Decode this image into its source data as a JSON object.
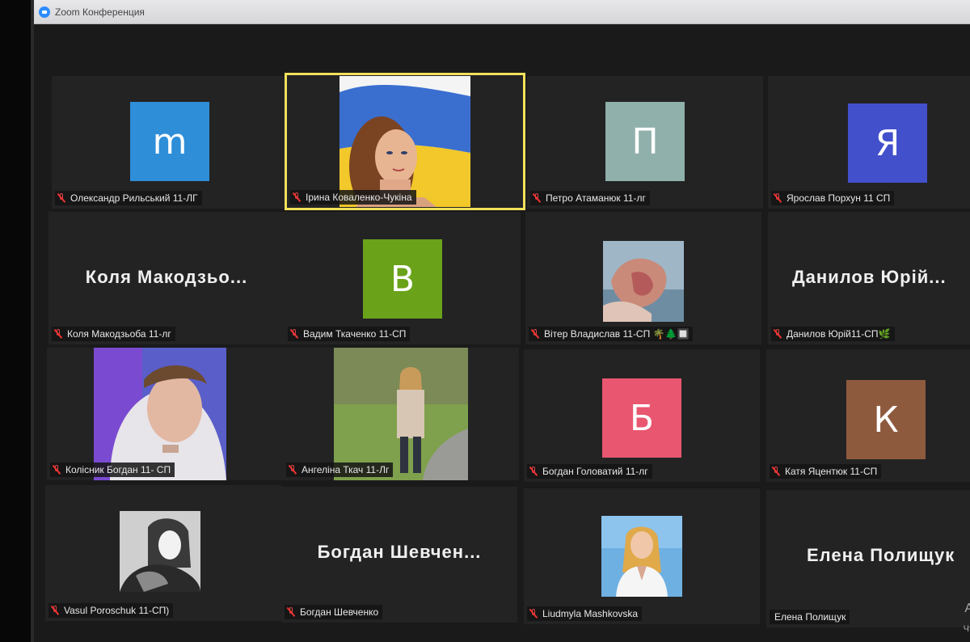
{
  "window": {
    "title": "Zoom Конференция"
  },
  "participants": [
    {
      "name": "Олександр Рильський 11-ЛГ",
      "avatar_letter": "m",
      "avatar_color": "#2e8ed8",
      "muted": true
    },
    {
      "name": "Ірина Коваленко-Чукіна",
      "muted": true,
      "active_speaker": true,
      "video": "flag-portrait"
    },
    {
      "name": "Петро Атаманюк 11-лг",
      "avatar_letter": "П",
      "avatar_color": "#8fb0ab",
      "muted": true
    },
    {
      "name": "Ярослав Порхун 11 СП",
      "avatar_letter": "Я",
      "avatar_color": "#4350cc",
      "muted": true
    },
    {
      "name": "Коля Макодзьоба 11-лг",
      "display_name": "Коля  Макодзьо...",
      "muted": true
    },
    {
      "name": "Вадим Ткаченко 11-СП",
      "avatar_letter": "В",
      "avatar_color": "#6aa219",
      "muted": true
    },
    {
      "name": "Вітер Владислав 11-СП 🌴🌲🔲",
      "muted": true,
      "video": "hands-photo"
    },
    {
      "name": "Данилов Юрій11-СП🌿",
      "display_name": "Данилов  Юрій...",
      "muted": true
    },
    {
      "name": "Колісник Богдан 11- СП",
      "muted": true,
      "video": "boy-hoodie"
    },
    {
      "name": "Ангеліна Ткач 11-Лг",
      "muted": true,
      "video": "girl-park"
    },
    {
      "name": "Богдан Головатий 11-лг",
      "avatar_letter": "Б",
      "avatar_color": "#e85670",
      "muted": true
    },
    {
      "name": "Катя Яцентюк 11-СП",
      "avatar_letter": "К",
      "avatar_color": "#8e5a3e",
      "muted": true
    },
    {
      "name": "Vasul Poroschuk 11-СП)",
      "muted": true,
      "video": "bw-photo"
    },
    {
      "name": "Богдан Шевченко",
      "display_name": "Богдан  Шевчен...",
      "muted": true
    },
    {
      "name": "Liudmyla Mashkovska",
      "muted": true,
      "video": "woman-blue"
    },
    {
      "name": "Елена Полищук",
      "display_name": "Елена  Полищук",
      "muted": false
    }
  ],
  "edge": {
    "letter": "А",
    "small": "Чт"
  }
}
